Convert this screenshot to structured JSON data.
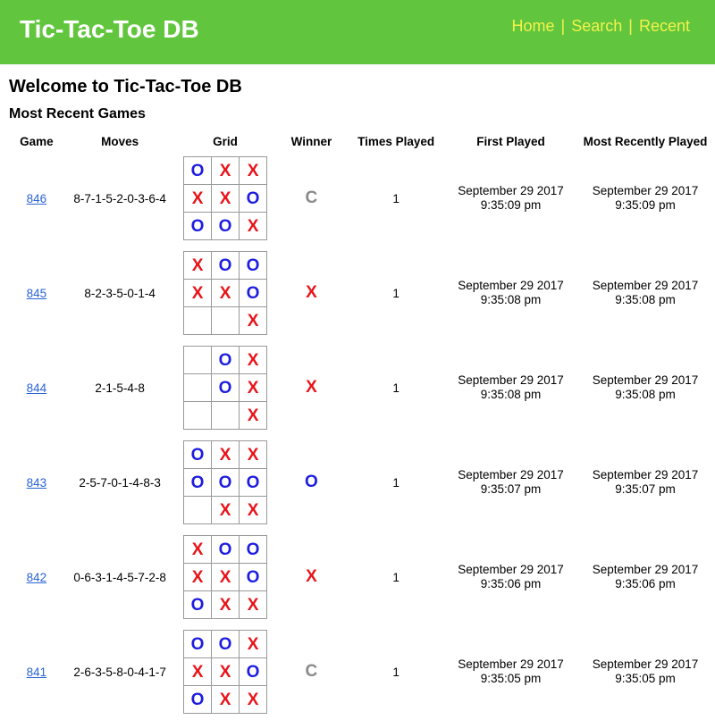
{
  "header": {
    "site_title": "Tic-Tac-Toe DB",
    "nav": [
      "Home",
      "Search",
      "Recent"
    ],
    "nav_separator": "|",
    "colors": {
      "background": "#61c63e",
      "title": "#ffffff",
      "nav": "#f2f24a"
    }
  },
  "page": {
    "welcome": "Welcome to Tic-Tac-Toe DB",
    "section_title": "Most Recent Games"
  },
  "table": {
    "columns": [
      "Game",
      "Moves",
      "Grid",
      "Winner",
      "Times Played",
      "First Played",
      "Most Recently Played"
    ],
    "rows": [
      {
        "game": "846",
        "moves": "8-7-1-5-2-0-3-6-4",
        "grid": [
          "O",
          "X",
          "X",
          "X",
          "X",
          "O",
          "O",
          "O",
          "X"
        ],
        "winner": "C",
        "times_played": "1",
        "first_played": [
          "September 29 2017",
          "9:35:09 pm"
        ],
        "most_recently_played": [
          "September 29 2017",
          "9:35:09 pm"
        ]
      },
      {
        "game": "845",
        "moves": "8-2-3-5-0-1-4",
        "grid": [
          "X",
          "O",
          "O",
          "X",
          "X",
          "O",
          "",
          "",
          "X"
        ],
        "winner": "X",
        "times_played": "1",
        "first_played": [
          "September 29 2017",
          "9:35:08 pm"
        ],
        "most_recently_played": [
          "September 29 2017",
          "9:35:08 pm"
        ]
      },
      {
        "game": "844",
        "moves": "2-1-5-4-8",
        "grid": [
          "",
          "O",
          "X",
          "",
          "O",
          "X",
          "",
          "",
          "X"
        ],
        "winner": "X",
        "times_played": "1",
        "first_played": [
          "September 29 2017",
          "9:35:08 pm"
        ],
        "most_recently_played": [
          "September 29 2017",
          "9:35:08 pm"
        ]
      },
      {
        "game": "843",
        "moves": "2-5-7-0-1-4-8-3",
        "grid": [
          "O",
          "X",
          "X",
          "O",
          "O",
          "O",
          "",
          "X",
          "X"
        ],
        "winner": "O",
        "times_played": "1",
        "first_played": [
          "September 29 2017",
          "9:35:07 pm"
        ],
        "most_recently_played": [
          "September 29 2017",
          "9:35:07 pm"
        ]
      },
      {
        "game": "842",
        "moves": "0-6-3-1-4-5-7-2-8",
        "grid": [
          "X",
          "O",
          "O",
          "X",
          "X",
          "O",
          "O",
          "X",
          "X"
        ],
        "winner": "X",
        "times_played": "1",
        "first_played": [
          "September 29 2017",
          "9:35:06 pm"
        ],
        "most_recently_played": [
          "September 29 2017",
          "9:35:06 pm"
        ]
      },
      {
        "game": "841",
        "moves": "2-6-3-5-8-0-4-1-7",
        "grid": [
          "O",
          "O",
          "X",
          "X",
          "X",
          "O",
          "O",
          "X",
          "X"
        ],
        "winner": "C",
        "times_played": "1",
        "first_played": [
          "September 29 2017",
          "9:35:05 pm"
        ],
        "most_recently_played": [
          "September 29 2017",
          "9:35:05 pm"
        ]
      }
    ]
  }
}
